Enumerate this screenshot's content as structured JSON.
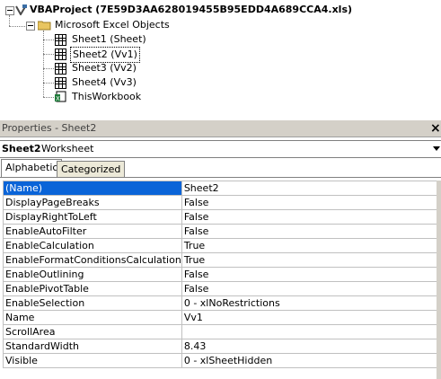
{
  "project": {
    "title": "VBAProject (7E59D3AA628019455B95EDD4A689CCA4.xls)",
    "folder": "Microsoft Excel Objects",
    "items": [
      {
        "label": "Sheet1 (Sheet)",
        "icon": "sheet-icon"
      },
      {
        "label": "Sheet2 (Vv1)",
        "icon": "sheet-icon",
        "selected": true
      },
      {
        "label": "Sheet3 (Vv2)",
        "icon": "sheet-icon"
      },
      {
        "label": "Sheet4 (Vv3)",
        "icon": "sheet-icon"
      },
      {
        "label": "ThisWorkbook",
        "icon": "workbook-icon"
      }
    ]
  },
  "properties": {
    "header": "Properties - Sheet2",
    "close_glyph": "×",
    "object_name": "Sheet2",
    "object_type": "Worksheet",
    "tabs": [
      "Alphabetic",
      "Categorized"
    ],
    "rows": [
      {
        "name": "(Name)",
        "value": "Sheet2"
      },
      {
        "name": "DisplayPageBreaks",
        "value": "False"
      },
      {
        "name": "DisplayRightToLeft",
        "value": "False"
      },
      {
        "name": "EnableAutoFilter",
        "value": "False"
      },
      {
        "name": "EnableCalculation",
        "value": "True"
      },
      {
        "name": "EnableFormatConditionsCalculation",
        "value": "True"
      },
      {
        "name": "EnableOutlining",
        "value": "False"
      },
      {
        "name": "EnablePivotTable",
        "value": "False"
      },
      {
        "name": "EnableSelection",
        "value": "0 - xlNoRestrictions"
      },
      {
        "name": "Name",
        "value": "Vv1"
      },
      {
        "name": "ScrollArea",
        "value": ""
      },
      {
        "name": "StandardWidth",
        "value": "8.43"
      },
      {
        "name": "Visible",
        "value": "0 - xlSheetHidden"
      }
    ]
  },
  "colors": {
    "selection": "#0a64d8",
    "panel": "#d4d0c8"
  }
}
